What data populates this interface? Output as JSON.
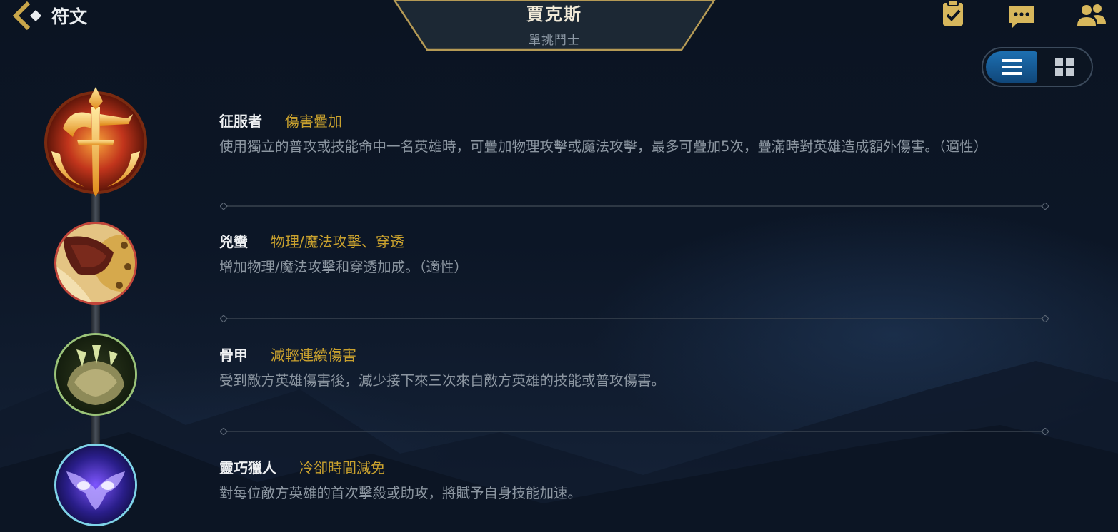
{
  "header": {
    "back_label": "符文",
    "champion_name": "賈克斯",
    "champion_role": "單挑鬥士"
  },
  "top_icons": [
    "checklist-icon",
    "chat-icon",
    "friends-icon"
  ],
  "view_toggle": {
    "selected": "list"
  },
  "runes": [
    {
      "name": "征服者",
      "tag": "傷害疊加",
      "desc": "使用獨立的普攻或技能命中一名英雄時，可疊加物理攻擊或魔法攻擊，最多可疊加5次，疊滿時對英雄造成額外傷害。（適性）",
      "icon": "conqueror-icon"
    },
    {
      "name": "兇蠻",
      "tag": "物理/魔法攻擊、穿透",
      "desc": "增加物理/魔法攻擊和穿透加成。（適性）",
      "icon": "brutal-icon"
    },
    {
      "name": "骨甲",
      "tag": "減輕連續傷害",
      "desc": "受到敵方英雄傷害後，減少接下來三次來自敵方英雄的技能或普攻傷害。",
      "icon": "bone-plating-icon"
    },
    {
      "name": "靈巧獵人",
      "tag": "冷卻時間減免",
      "desc": "對每位敵方英雄的首次擊殺或助攻，將賦予自身技能加速。",
      "icon": "ingenious-hunter-icon"
    }
  ],
  "colors": {
    "accent_gold": "#c9a12e",
    "toggle_blue": "#1d6fb1"
  }
}
